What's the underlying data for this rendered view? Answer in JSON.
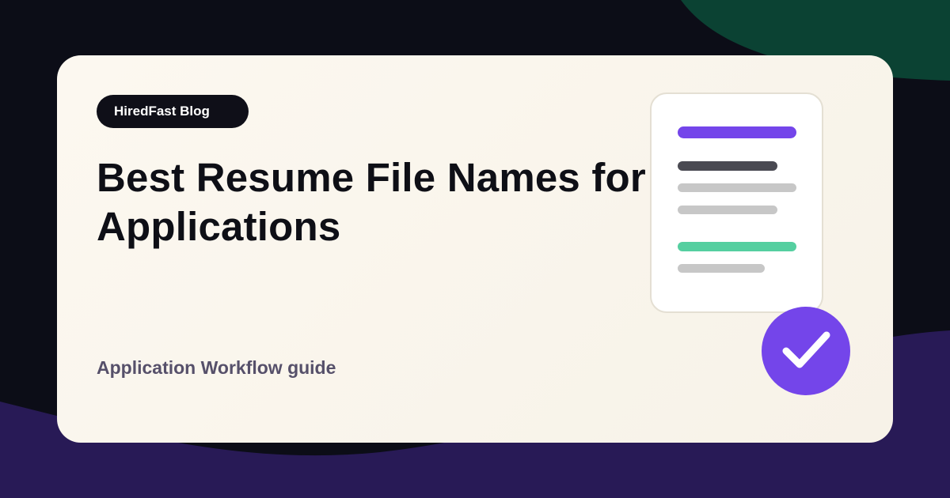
{
  "blog": {
    "badge_label": "HiredFast Blog",
    "title": "Best Resume File Names for Applications",
    "subtitle": "Application Workflow guide"
  },
  "illustration": {
    "document_icon": "resume-document-icon",
    "check_icon": "checkmark-icon"
  },
  "colors": {
    "page_background": "#0c0d17",
    "top_right_blob": "#0b4233",
    "bottom_blob": "#281a56",
    "card_background": "#f9f4ec",
    "badge_background": "#0f0f18",
    "accent_purple": "#7445ea",
    "accent_green": "#55cfa0",
    "line_dark": "#4a4a52",
    "line_light": "#c7c7c7",
    "subtitle_text": "#56506a"
  }
}
